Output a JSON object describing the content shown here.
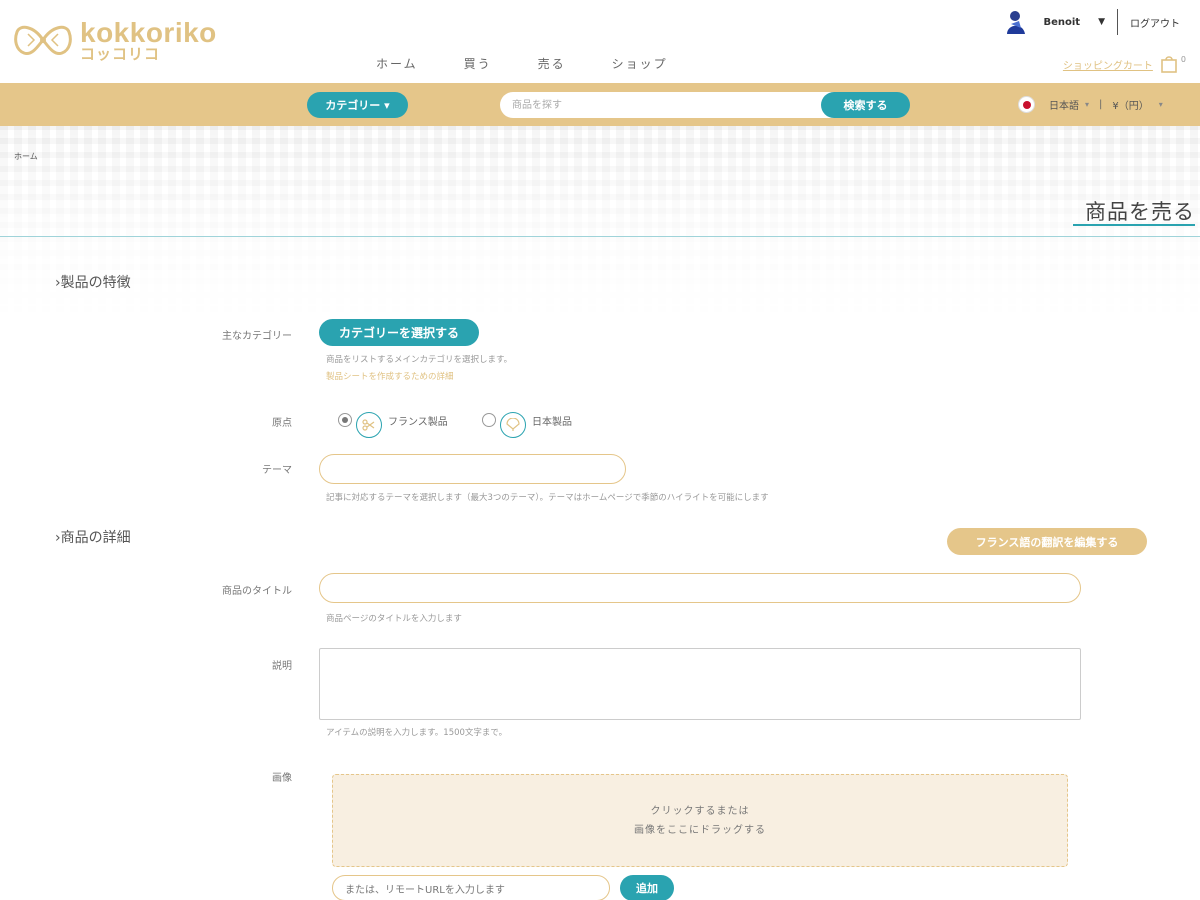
{
  "header": {
    "logo_word": "kokkoriko",
    "logo_kana": "コッコリコ",
    "nav": [
      "ホーム",
      "買う",
      "売る",
      "ショップ"
    ],
    "username": "Benoit",
    "logout": "ログアウト",
    "cart_link": "ショッピングカート",
    "cart_count": "0"
  },
  "searchbar": {
    "category_button": "カテゴリー ▾",
    "search_placeholder": "商品を探す",
    "search_button": "検索する",
    "language": "日本語",
    "language_caret": "▾",
    "currency": "¥（円）",
    "currency_caret": "▾"
  },
  "breadcrumb": "ホーム",
  "page_title": "商品を売る",
  "section_features": {
    "heading": "製品の特徴",
    "main_category_label": "主なカテゴリー",
    "select_category_button": "カテゴリーを選択する",
    "category_hint": "商品をリストするメインカテゴリを選択します。",
    "category_link": "製品シートを作成するための詳細",
    "origin_label": "原点",
    "origin_options": [
      {
        "label": "フランス製品",
        "selected": true
      },
      {
        "label": "日本製品",
        "selected": false
      }
    ],
    "theme_label": "テーマ",
    "theme_hint": "記事に対応するテーマを選択します（最大3つのテーマ）。テーマはホームページで季節のハイライトを可能にします"
  },
  "section_details": {
    "heading": "商品の詳細",
    "edit_french_button": "フランス語の翻訳を編集する",
    "title_label": "商品のタイトル",
    "title_hint": "商品ページのタイトルを入力します",
    "description_label": "説明",
    "description_hint": "アイテムの説明を入力します。1500文字まで。",
    "image_label": "画像",
    "dropzone_line1": "クリックするまたは",
    "dropzone_line2": "画像をここにドラッグする",
    "url_placeholder": "または、リモートURLを入力します",
    "add_button": "追加"
  },
  "colors": {
    "accent_teal": "#2aa3b0",
    "brand_gold": "#e5c68a"
  }
}
